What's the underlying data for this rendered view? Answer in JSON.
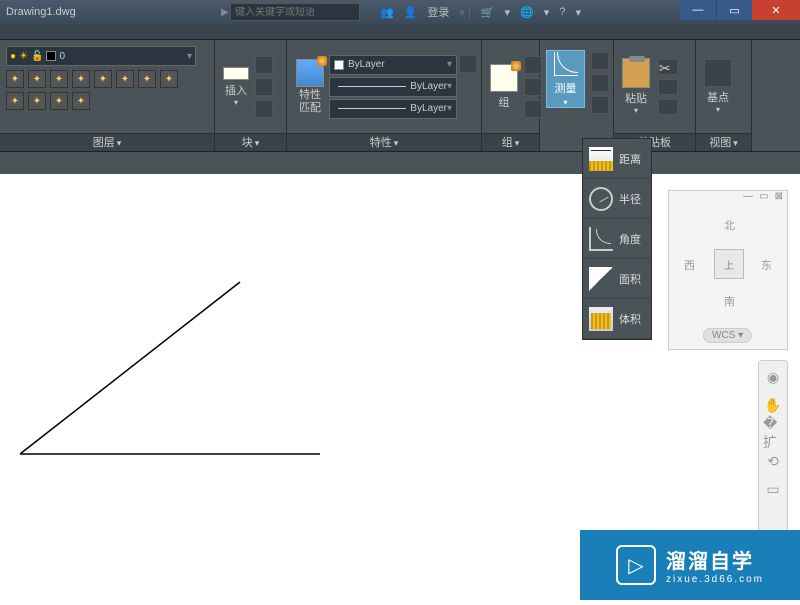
{
  "titlebar": {
    "filename": "Drawing1.dwg",
    "search_placeholder": "键入关键字或短语",
    "login_label": "登录"
  },
  "ribbon": {
    "layer": {
      "title": "图层",
      "current": "0"
    },
    "block": {
      "title": "块",
      "insert_label": "插入"
    },
    "properties": {
      "title": "特性",
      "match_label": "特性\n匹配",
      "color": "ByLayer",
      "lineweight": "ByLayer",
      "linetype": "ByLayer"
    },
    "group": {
      "title": "组",
      "label": "组"
    },
    "utilities": {
      "measure_label": "测量"
    },
    "clipboard": {
      "title": "剪贴板",
      "paste_label": "粘贴"
    },
    "view": {
      "title": "视图",
      "base_label": "基点"
    }
  },
  "measure_menu": {
    "distance": "距离",
    "radius": "半径",
    "angle": "角度",
    "area": "面积",
    "volume": "体积"
  },
  "viewcube": {
    "north": "北",
    "south": "南",
    "west": "西",
    "east": "东",
    "top": "上",
    "wcs": "WCS"
  },
  "watermark": {
    "title": "溜溜自学",
    "subtitle": "zixue.3d66.com"
  }
}
